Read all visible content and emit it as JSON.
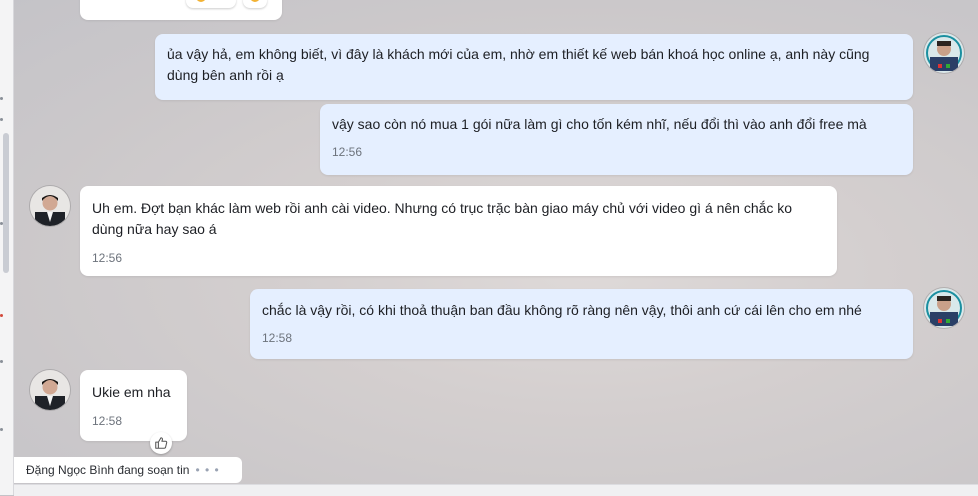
{
  "contact": {
    "typing_text": "Đặng Ngọc Bình đang soạn tin",
    "typing_dots": "• • •"
  },
  "messages": [
    {
      "direction": "out",
      "text": "ủa vậy hả, em không biết, vì đây là khách mới của em, nhờ em thiết kế web bán khoá học online ạ, anh này cũng dùng bên anh rồi ạ",
      "time": ""
    },
    {
      "direction": "out",
      "text": "vậy sao còn nó mua 1 gói nữa làm gì cho tốn kém nhĩ, nếu đổi thì vào anh đổi free mà",
      "time": "12:56"
    },
    {
      "direction": "in",
      "text": "Uh em. Đợt bạn khác làm web rồi anh cài video. Nhưng có trục trặc bàn giao máy chủ với video gì á nên chắc ko dùng nữa hay sao á",
      "time": "12:56"
    },
    {
      "direction": "out",
      "text": "chắc là vậy rồi, có khi thoả thuận ban đầu không rõ ràng nên vậy, thôi anh cứ cái lên cho em nhé",
      "time": "12:58"
    },
    {
      "direction": "in",
      "text": "Ukie em nha",
      "time": "12:58"
    }
  ],
  "reaction_icons": [
    "thumbs-up-icon"
  ],
  "colors": {
    "outgoing_bubble": "#e5efff",
    "incoming_bubble": "#ffffff"
  }
}
